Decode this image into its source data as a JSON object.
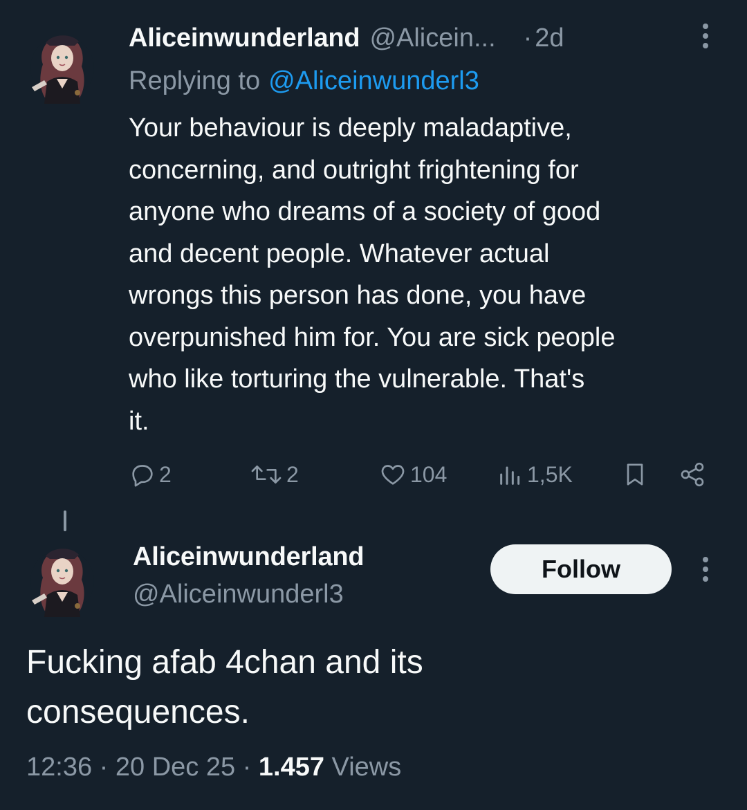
{
  "reply_tweet": {
    "author_name": "Aliceinwunderland",
    "author_handle": "@Alicein...",
    "separator": "·",
    "time": "2d",
    "replying_prefix": "Replying to",
    "replying_handle": "@Aliceinwunderl3",
    "text": "Your behaviour is deeply maladaptive,\nconcerning, and outright frightening for\nanyone who dreams of a society of good\nand decent people. Whatever actual\nwrongs this person has done, you have\noverpunished him for. You are sick people\nwho like torturing the vulnerable. That's\nit.",
    "actions": {
      "replies": "2",
      "retweets": "2",
      "likes": "104",
      "views": "1,5K"
    }
  },
  "main_tweet": {
    "author_name": "Aliceinwunderland",
    "author_handle": "@Aliceinwunderl3",
    "follow_label": "Follow",
    "text": "Fucking afab 4chan and its\nconsequences.",
    "time": "12:36",
    "date": "20 Dec 25",
    "views_count": "1.457",
    "views_label": "Views",
    "separator": "·"
  },
  "colors": {
    "background": "#15202b",
    "text": "#f7f9f9",
    "muted": "#8b98a5",
    "accent": "#1d9bf0",
    "follow_bg": "#eff3f4"
  },
  "icons": [
    "avatar",
    "more-icon",
    "reply-icon",
    "retweet-icon",
    "like-icon",
    "views-icon",
    "bookmark-icon",
    "share-icon"
  ]
}
